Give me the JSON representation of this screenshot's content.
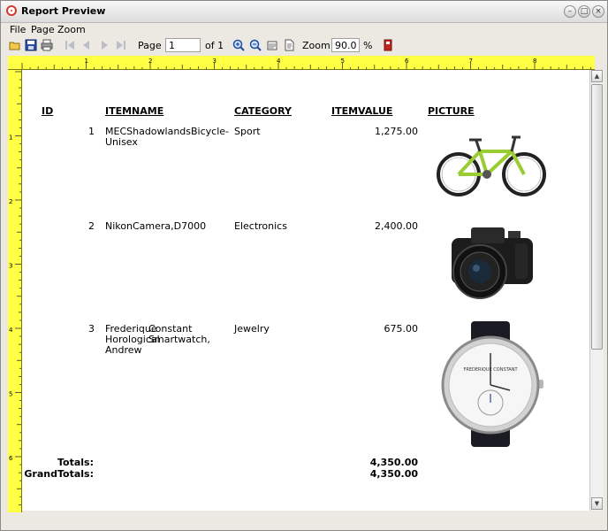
{
  "window": {
    "title": "Report Preview"
  },
  "menu": [
    {
      "label": "File"
    },
    {
      "label": "Page"
    },
    {
      "label": "Zoom"
    }
  ],
  "toolbar": {
    "page_label": "Page",
    "page_value": "1",
    "page_of": "of 1",
    "zoom_label": "Zoom",
    "zoom_value": "90.0",
    "zoom_unit": "%"
  },
  "ruler": {
    "top_marks": [
      "1",
      "2",
      "3",
      "4",
      "5",
      "6",
      "7",
      "8"
    ],
    "left_marks": [
      "1",
      "2",
      "3",
      "4",
      "5",
      "6"
    ]
  },
  "report": {
    "headers": {
      "id": "ID",
      "itemname": "ITEMNAME",
      "category": "CATEGORY",
      "itemvalue": "ITEMVALUE",
      "picture": "PICTURE"
    },
    "rows": [
      {
        "id": "1",
        "name_line1": "MECShadowlandsBicycle-",
        "name_line2": "Unisex",
        "name_line3": "",
        "name_col2": "",
        "category": "Sport",
        "value": "1,275.00",
        "picture": "bicycle"
      },
      {
        "id": "2",
        "name_line1": "NikonCamera,D7000",
        "name_line2": "",
        "name_line3": "",
        "name_col2": "",
        "category": "Electronics",
        "value": "2,400.00",
        "picture": "camera"
      },
      {
        "id": "3",
        "name_line1": "Frederique",
        "name_line2": "Horological",
        "name_line3": "Andrew",
        "name_col2_line1": "Constant",
        "name_col2_line2": "Smartwatch,",
        "category": "Jewelry",
        "value": "675.00",
        "picture": "watch"
      }
    ],
    "totals": {
      "label": "Totals:",
      "value": "4,350.00"
    },
    "grand_totals": {
      "label": "GrandTotals:",
      "value": "4,350.00"
    }
  },
  "watch_face_text": "FREDERIQUE CONSTANT"
}
